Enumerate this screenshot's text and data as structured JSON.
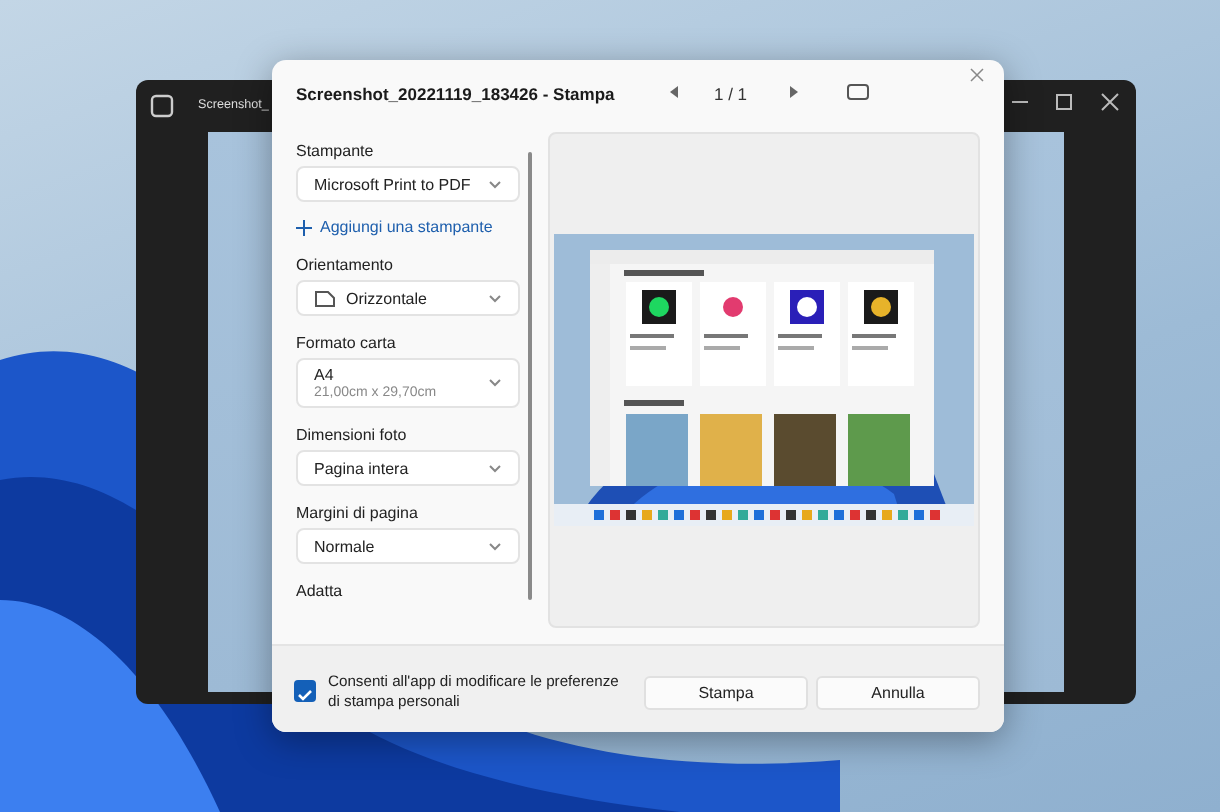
{
  "background_window": {
    "title": "Screenshot_"
  },
  "dialog": {
    "title": "Screenshot_20221119_183426 - Stampa",
    "page_indicator": "1 / 1",
    "settings": [
      {
        "kind": "label",
        "text": "Stampante"
      },
      {
        "kind": "dropdown",
        "value": "Microsoft Print to PDF"
      },
      {
        "kind": "link",
        "text": "Aggiungi una stampante"
      },
      {
        "kind": "label",
        "text": "Orientamento"
      },
      {
        "kind": "icon-dropdown",
        "value": "Orizzontale"
      },
      {
        "kind": "label",
        "text": "Formato carta"
      },
      {
        "kind": "dropdown",
        "value": "A4",
        "detail": "21,00cm x 29,70cm"
      },
      {
        "kind": "label",
        "text": "Dimensioni foto"
      },
      {
        "kind": "dropdown",
        "value": "Pagina intera"
      },
      {
        "kind": "label",
        "text": "Margini di pagina"
      },
      {
        "kind": "dropdown",
        "value": "Normale"
      },
      {
        "kind": "label",
        "text": "Adatta"
      }
    ],
    "consent": {
      "text": "Consenti all'app di modificare le preferenze di stampa personali",
      "checked": true
    },
    "buttons": [
      "Stampa",
      "Annulla"
    ]
  }
}
